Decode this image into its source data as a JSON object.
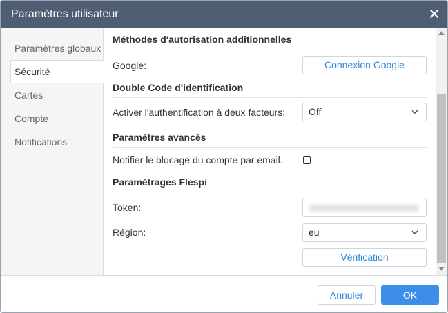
{
  "dialog": {
    "title": "Paramètres utilisateur",
    "close_icon": "close-icon"
  },
  "sidebar": {
    "items": [
      {
        "label": "Paramètres globaux",
        "active": false
      },
      {
        "label": "Sécurité",
        "active": true
      },
      {
        "label": "Cartes",
        "active": false
      },
      {
        "label": "Compte",
        "active": false
      },
      {
        "label": "Notifications",
        "active": false
      }
    ]
  },
  "security": {
    "auth_section_title": "Méthodes d'autorisation additionnelles",
    "google_label": "Google:",
    "google_button": "Connexion Google",
    "twofa_section_title": "Double Code d'identification",
    "twofa_label": "Activer l'authentification à deux facteurs:",
    "twofa_value": "Off",
    "advanced_section_title": "Paramètres avancés",
    "notify_label": "Notifier le blocage du compte par email.",
    "notify_checked": false,
    "flespi_section_title": "Paramètrages Flespi",
    "token_label": "Token:",
    "region_label": "Région:",
    "region_value": "eu",
    "verify_button": "Vérification"
  },
  "footer": {
    "cancel_label": "Annuler",
    "ok_label": "OK"
  },
  "colors": {
    "titlebar": "#4f5e72",
    "accent": "#3d8ee8",
    "link": "#2e86de"
  }
}
